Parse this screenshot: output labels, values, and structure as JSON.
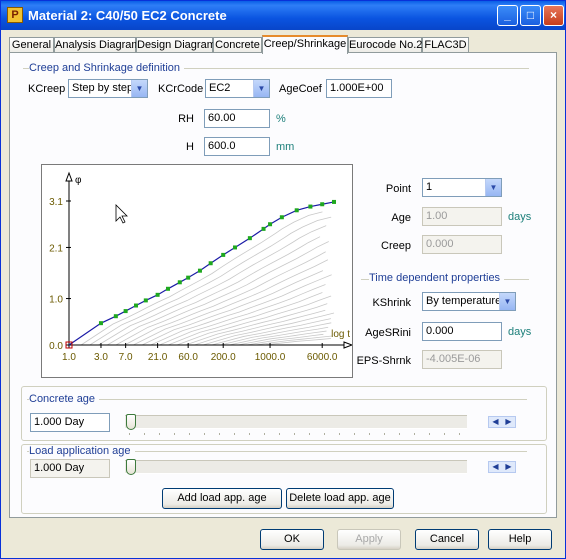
{
  "window": {
    "title": "Material 2: C40/50 EC2 Concrete",
    "app_icon": "plaxis-icon",
    "controls": {
      "minimize": "_",
      "maximize": "□",
      "close": "×"
    }
  },
  "tabs": [
    "General",
    "Analysis Diagram",
    "Design Diagram",
    "Concrete",
    "Creep/Shrinkage",
    "Eurocode No.2",
    "FLAC3D"
  ],
  "active_tab": "Creep/Shrinkage",
  "creep": {
    "group_title": "Creep and Shrinkage definition",
    "kcreep_label": "KCreep",
    "kcreep_value": "Step by step",
    "kcrcode_label": "KCrCode",
    "kcrcode_value": "EC2",
    "agecoef_label": "AgeCoef",
    "agecoef_value": "1.000E+00",
    "rh_label": "RH",
    "rh_value": "60.00",
    "rh_unit": "%",
    "h_label": "H",
    "h_value": "600.0",
    "h_unit": "mm"
  },
  "chart_data": {
    "type": "line",
    "ylabel": "φ",
    "xlabel": "log t",
    "x_scale": "log",
    "x_ticks": [
      "1.0",
      "3.0",
      "7.0",
      "21.0",
      "60.0",
      "200.0",
      "1000.0",
      "6000.0"
    ],
    "y_ticks": [
      "0.0",
      "1.0",
      "2.1",
      "3.1"
    ],
    "ylim": [
      0,
      3.1
    ],
    "series": [
      {
        "color": "#1a1aa6",
        "marker_color": "#1fa81f",
        "x": [
          1,
          3,
          5,
          7,
          10,
          14,
          21,
          30,
          45,
          60,
          90,
          130,
          200,
          300,
          500,
          800,
          1000,
          1500,
          2500,
          4000,
          6000,
          9000
        ],
        "y": [
          0.0,
          0.47,
          0.62,
          0.73,
          0.85,
          0.96,
          1.08,
          1.21,
          1.35,
          1.45,
          1.6,
          1.76,
          1.94,
          2.1,
          2.3,
          2.5,
          2.6,
          2.75,
          2.9,
          2.98,
          3.03,
          3.08
        ]
      }
    ],
    "background_curves": 22,
    "grid": false
  },
  "point": {
    "point_label": "Point",
    "point_value": "1",
    "age_label": "Age",
    "age_value": "1.00",
    "age_unit": "days",
    "creep_label": "Creep",
    "creep_value": "0.000"
  },
  "time_props": {
    "group_title": "Time dependent properties",
    "kshrink_label": "KShrink",
    "kshrink_value": "By temperatures",
    "agesrini_label": "AgeSRini",
    "agesrini_value": "0.000",
    "agesrini_unit": "days",
    "eps_label": "EPS-Shrnk",
    "eps_value": "-4.005E-06"
  },
  "concrete_age": {
    "group_title": "Concrete age",
    "value": "1.000 Day"
  },
  "load_age": {
    "group_title": "Load application age",
    "value": "1.000 Day",
    "add_label": "Add load app. age",
    "delete_label": "Delete load app. age"
  },
  "footer": {
    "ok": "OK",
    "apply": "Apply",
    "cancel": "Cancel",
    "help": "Help"
  }
}
